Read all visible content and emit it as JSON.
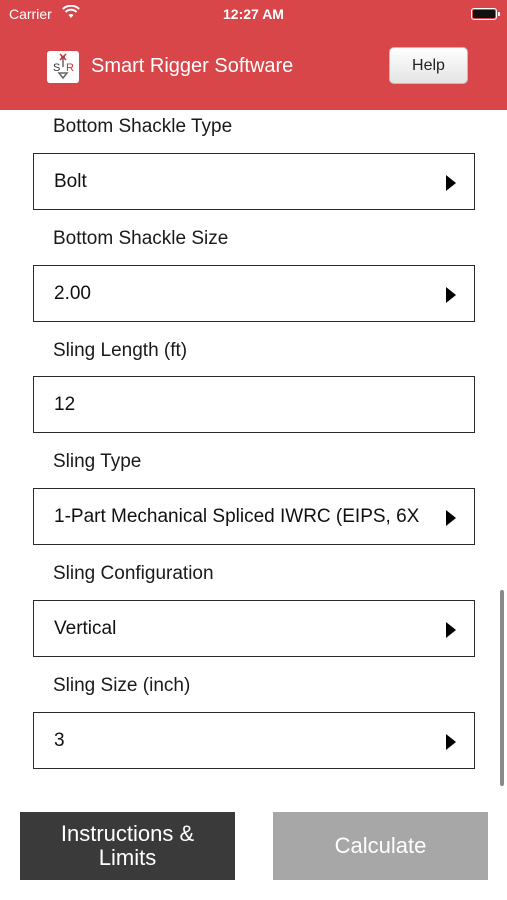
{
  "status_bar": {
    "carrier": "Carrier",
    "time": "12:27 AM",
    "wifi_icon": "wifi-icon",
    "battery_icon": "battery-icon"
  },
  "header": {
    "title": "Smart Rigger Software",
    "logo_icon": "app-logo-icon",
    "help_label": "Help",
    "background_color": "#d9464a"
  },
  "form": {
    "fields": [
      {
        "label": "Bottom Shackle Type",
        "value": "Bolt",
        "kind": "picker"
      },
      {
        "label": "Bottom Shackle Size",
        "value": "2.00",
        "kind": "picker"
      },
      {
        "label": "Sling Length (ft)",
        "value": "12",
        "kind": "text"
      },
      {
        "label": "Sling Type",
        "value": "1-Part Mechanical Spliced IWRC (EIPS, 6X",
        "kind": "picker"
      },
      {
        "label": "Sling Configuration",
        "value": "Vertical",
        "kind": "picker"
      },
      {
        "label": "Sling Size (inch)",
        "value": "3",
        "kind": "picker"
      }
    ]
  },
  "footer": {
    "instructions_label": "Instructions & Limits",
    "calculate_label": "Calculate"
  }
}
